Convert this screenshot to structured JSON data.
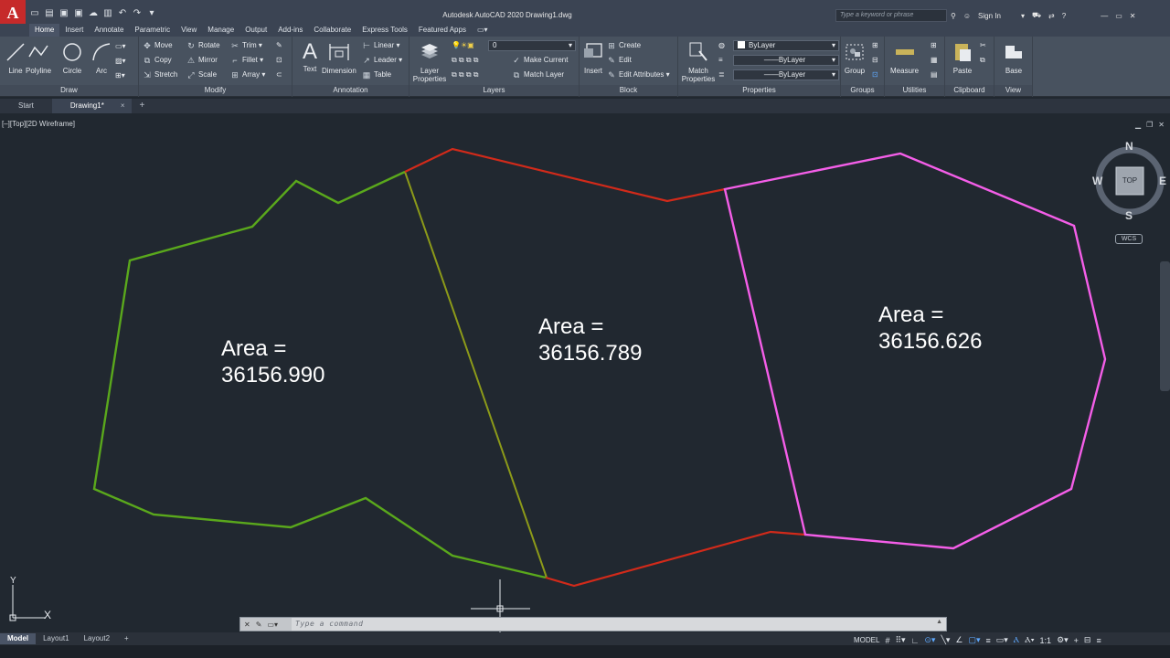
{
  "app": {
    "logo": "A",
    "title": "Autodesk AutoCAD 2020   Drawing1.dwg",
    "search_placeholder": "Type a keyword or phrase",
    "sign_in": "Sign In"
  },
  "ribbon_tabs": [
    "Home",
    "Insert",
    "Annotate",
    "Parametric",
    "View",
    "Manage",
    "Output",
    "Add-ins",
    "Collaborate",
    "Express Tools",
    "Featured Apps"
  ],
  "ribbon": {
    "draw": {
      "title": "Draw",
      "line": "Line",
      "polyline": "Polyline",
      "circle": "Circle",
      "arc": "Arc"
    },
    "modify": {
      "title": "Modify",
      "move": "Move",
      "rotate": "Rotate",
      "trim": "Trim",
      "copy": "Copy",
      "mirror": "Mirror",
      "fillet": "Fillet",
      "stretch": "Stretch",
      "scale": "Scale",
      "array": "Array"
    },
    "annotation": {
      "title": "Annotation",
      "text": "Text",
      "dimension": "Dimension",
      "linear": "Linear",
      "leader": "Leader",
      "table": "Table"
    },
    "layers": {
      "title": "Layers",
      "layer_properties": "Layer Properties",
      "layer_value": "0",
      "make_current": "Make Current",
      "match_layer": "Match Layer"
    },
    "block": {
      "title": "Block",
      "insert": "Insert",
      "create": "Create",
      "edit": "Edit",
      "edit_attributes": "Edit Attributes"
    },
    "properties": {
      "title": "Properties",
      "match_properties": "Match Properties",
      "color": "ByLayer",
      "linetype": "ByLayer",
      "lineweight": "ByLayer"
    },
    "groups": {
      "title": "Groups",
      "group": "Group"
    },
    "utilities": {
      "title": "Utilities",
      "measure": "Measure"
    },
    "clipboard": {
      "title": "Clipboard",
      "paste": "Paste"
    },
    "view": {
      "title": "View",
      "base": "Base"
    }
  },
  "doc_tabs": {
    "start": "Start",
    "drawing": "Drawing1*",
    "close": "×",
    "new": "+"
  },
  "viewport": {
    "label": "[–][Top][2D Wireframe]"
  },
  "drawing": {
    "areas": [
      {
        "line1": "Area =",
        "line2": "36156.990"
      },
      {
        "line1": "Area =",
        "line2": "36156.789"
      },
      {
        "line1": "Area =",
        "line2": "36156.626"
      }
    ],
    "colors": {
      "green": "#5aa81c",
      "olive": "#8c9a19",
      "red": "#d12a1a",
      "magenta": "#f45ee8"
    }
  },
  "viewcube": {
    "top": "TOP",
    "n": "N",
    "s": "S",
    "e": "E",
    "w": "W",
    "wcs": "WCS"
  },
  "ucs": {
    "x": "X",
    "y": "Y"
  },
  "command": {
    "placeholder": "Type  a  command"
  },
  "status": {
    "model_tab": "Model",
    "layout1": "Layout1",
    "layout2": "Layout2",
    "add": "+",
    "model": "MODEL",
    "scale": "1:1"
  }
}
